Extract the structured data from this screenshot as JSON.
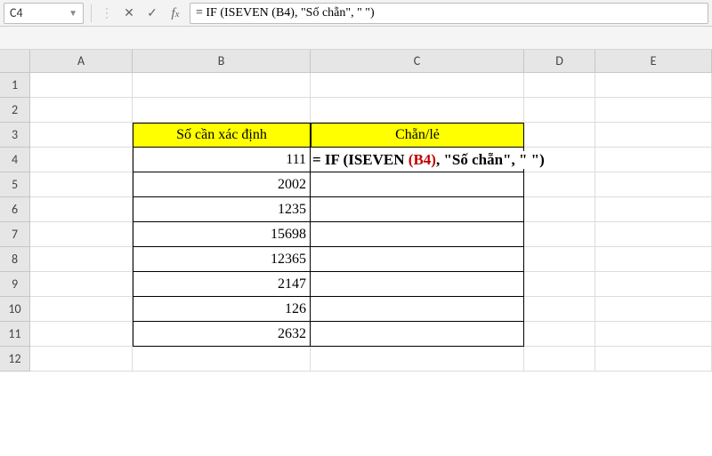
{
  "name_box": "C4",
  "formula_text": "= IF (ISEVEN (B4), \"Số chẵn\", \" \")",
  "columns": [
    "A",
    "B",
    "C",
    "D",
    "E"
  ],
  "rows": [
    "1",
    "2",
    "3",
    "4",
    "5",
    "6",
    "7",
    "8",
    "9",
    "10",
    "11",
    "12"
  ],
  "header": {
    "b3": "Số cần xác định",
    "c3": "Chẵn/lẻ"
  },
  "data": {
    "b4": "111",
    "b5": "2002",
    "b6": "1235",
    "b7": "15698",
    "b8": "12365",
    "b9": "2147",
    "b10": "126",
    "b11": "2632"
  },
  "cell_formula": {
    "pre": "= IF (ISEVEN ",
    "mid": "(B4)",
    "post": ", \"Số chẵn\", \" \")"
  }
}
